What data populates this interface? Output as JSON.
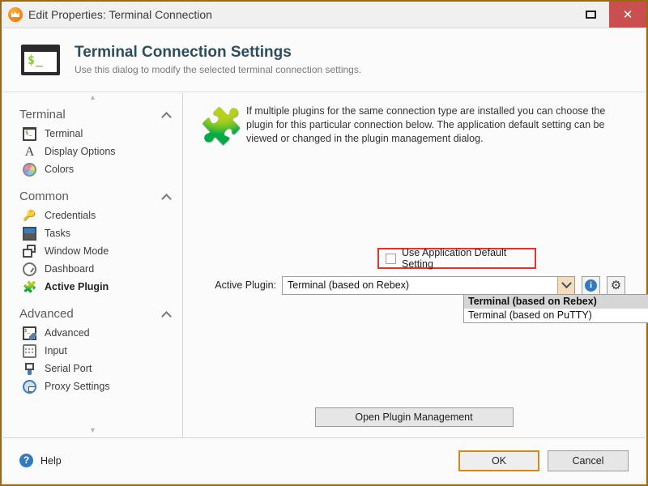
{
  "window": {
    "title": "Edit Properties: Terminal Connection",
    "icon": "app-icon",
    "maximize_label": "",
    "close_label": "✕"
  },
  "header": {
    "icon": "terminal-icon",
    "prompt_glyph": "$_",
    "title": "Terminal Connection Settings",
    "subtitle": "Use this dialog to modify the selected terminal connection settings."
  },
  "sidebar": {
    "scroll_up": "▲",
    "scroll_down": "▼",
    "groups": [
      {
        "title": "Terminal",
        "chevron": "chevron-up-icon",
        "items": [
          {
            "label": "Terminal",
            "icon": "terminal-icon",
            "selected": false
          },
          {
            "label": "Display Options",
            "icon": "font-icon",
            "selected": false
          },
          {
            "label": "Colors",
            "icon": "color-wheel-icon",
            "selected": false
          }
        ]
      },
      {
        "title": "Common",
        "chevron": "chevron-up-icon",
        "items": [
          {
            "label": "Credentials",
            "icon": "key-icon",
            "selected": false
          },
          {
            "label": "Tasks",
            "icon": "window-icon",
            "selected": false
          },
          {
            "label": "Window Mode",
            "icon": "cascade-windows-icon",
            "selected": false
          },
          {
            "label": "Dashboard",
            "icon": "gauge-icon",
            "selected": false
          },
          {
            "label": "Active Plugin",
            "icon": "puzzle-piece-icon",
            "selected": true
          }
        ]
      },
      {
        "title": "Advanced",
        "chevron": "chevron-up-icon",
        "items": [
          {
            "label": "Advanced",
            "icon": "terminal-wrench-icon",
            "selected": false
          },
          {
            "label": "Input",
            "icon": "keyboard-icon",
            "selected": false
          },
          {
            "label": "Serial Port",
            "icon": "serial-plug-icon",
            "selected": false
          },
          {
            "label": "Proxy Settings",
            "icon": "globe-icon",
            "selected": false
          }
        ]
      }
    ]
  },
  "content": {
    "intro_icon": "puzzle-piece-icon",
    "intro_text": "If multiple plugins for the same connection type are installed you can choose the plugin for this particular connection below. The application default setting can be viewed or changed in the plugin management dialog.",
    "checkbox": {
      "label": "Use Application Default Setting",
      "checked": false,
      "highlight_color": "#e2352c"
    },
    "active_plugin": {
      "label": "Active Plugin:",
      "value": "Terminal (based on Rebex)",
      "arrow_icon": "chevron-down-icon",
      "info_button": "info-icon",
      "info_glyph": "i",
      "settings_button": "gear-icon",
      "gear_glyph": "✜",
      "options": [
        {
          "label": "Terminal (based on Rebex)",
          "highlighted": true
        },
        {
          "label": "Terminal (based on PuTTY)",
          "highlighted": false
        }
      ]
    },
    "open_plugin_management": "Open Plugin Management"
  },
  "footer": {
    "help_label": "Help",
    "help_icon": "question-icon",
    "help_glyph": "?",
    "ok_label": "OK",
    "cancel_label": "Cancel",
    "focus_color": "#cf8a1a"
  }
}
